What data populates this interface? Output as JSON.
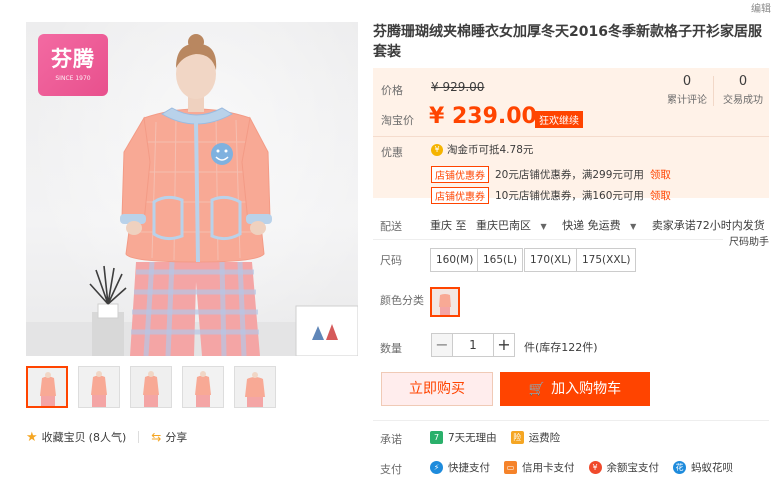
{
  "top": {
    "edit_label": "编辑"
  },
  "gallery": {
    "brand_logo_text": "芬腾",
    "brand_logo_sub": "SINCE 1970",
    "favorite_label": "收藏宝贝",
    "favorite_count": "(8人气)",
    "share_label": "分享",
    "thumbnail_count": 5
  },
  "product": {
    "title": "芬腾珊瑚绒夹棉睡衣女加厚冬天2016冬季新款格子开衫家居服套装",
    "price_label": "价格",
    "original_price": "¥ 929.00",
    "taobao_price_label": "淘宝价",
    "current_price": "¥ 239.00",
    "promo_tag": "狂欢继续",
    "stats": [
      {
        "value": "0",
        "label": "累计评论"
      },
      {
        "value": "0",
        "label": "交易成功"
      }
    ],
    "discount_label": "优惠",
    "coin_text": "淘金币可抵4.78元",
    "coupons": [
      {
        "tag": "店铺优惠券",
        "text": "20元店铺优惠券，满299元可用",
        "action": "领取"
      },
      {
        "tag": "店铺优惠券",
        "text": "10元店铺优惠券，满160元可用",
        "action": "领取"
      }
    ]
  },
  "shipping": {
    "label": "配送",
    "from": "重庆 至",
    "to": "重庆巴南区",
    "method": "快递 免运费",
    "promise": "卖家承诺72小时内发货",
    "help": "尺码助手"
  },
  "size": {
    "label": "尺码",
    "options": [
      "160(M)",
      "165(L)",
      "170(XL)",
      "175(XXL)"
    ]
  },
  "color": {
    "label": "颜色分类"
  },
  "quantity": {
    "label": "数量",
    "value": "1",
    "minus": "−",
    "plus": "+",
    "stock": "件(库存122件)"
  },
  "actions": {
    "buy_now": "立即购买",
    "add_to_cart": "加入购物车"
  },
  "promise": {
    "label": "承诺",
    "items": [
      {
        "icon": "seven-days-return-icon",
        "text": "7天无理由",
        "color": "#2ab06b"
      },
      {
        "icon": "shipping-insurance-icon",
        "text": "运费险",
        "color": "#f5a623"
      }
    ]
  },
  "payment": {
    "label": "支付",
    "items": [
      {
        "icon": "quick-pay-icon",
        "text": "快捷支付",
        "color": "#1e8bdc"
      },
      {
        "icon": "credit-card-icon",
        "text": "信用卡支付",
        "color": "#f5832a"
      },
      {
        "icon": "yuebao-icon",
        "text": "余额宝支付",
        "color": "#f04a2c"
      },
      {
        "icon": "huabei-icon",
        "text": "蚂蚁花呗",
        "color": "#1e8bdc"
      }
    ]
  },
  "colors": {
    "accent": "#ff4400",
    "price_bg": "#fff2e8",
    "buy_now_bg": "#ffeded"
  }
}
